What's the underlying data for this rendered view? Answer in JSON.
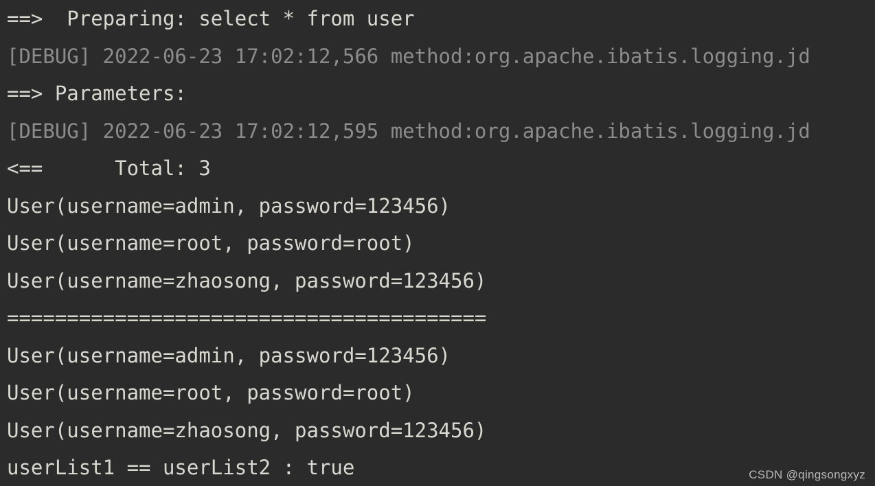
{
  "window": {
    "kind": "ide-console-output",
    "background_color": "#2b2b2b",
    "output_text_color": "#d8d8d0",
    "debug_text_color": "#8c8c8c"
  },
  "console": {
    "lines": [
      {
        "id": "line-1",
        "type": "output",
        "text": "==>  Preparing: select * from user"
      },
      {
        "id": "line-2",
        "type": "debug",
        "text": "[DEBUG] 2022-06-23 17:02:12,566 method:org.apache.ibatis.logging.jd"
      },
      {
        "id": "line-3",
        "type": "output",
        "text": "==> Parameters:"
      },
      {
        "id": "line-4",
        "type": "debug",
        "text": "[DEBUG] 2022-06-23 17:02:12,595 method:org.apache.ibatis.logging.jd"
      },
      {
        "id": "line-5",
        "type": "output",
        "text": "<==      Total: 3"
      },
      {
        "id": "line-6",
        "type": "output",
        "text": "User(username=admin, password=123456)"
      },
      {
        "id": "line-7",
        "type": "output",
        "text": "User(username=root, password=root)"
      },
      {
        "id": "line-8",
        "type": "output",
        "text": "User(username=zhaosong, password=123456)"
      },
      {
        "id": "line-9",
        "type": "output",
        "text": "========================================"
      },
      {
        "id": "line-10",
        "type": "output",
        "text": "User(username=admin, password=123456)"
      },
      {
        "id": "line-11",
        "type": "output",
        "text": "User(username=root, password=root)"
      },
      {
        "id": "line-12",
        "type": "output",
        "text": "User(username=zhaosong, password=123456)"
      },
      {
        "id": "line-13",
        "type": "output",
        "text": "userList1 == userList2 : true"
      }
    ]
  },
  "watermark": {
    "text": "CSDN @qingsongxyz"
  }
}
